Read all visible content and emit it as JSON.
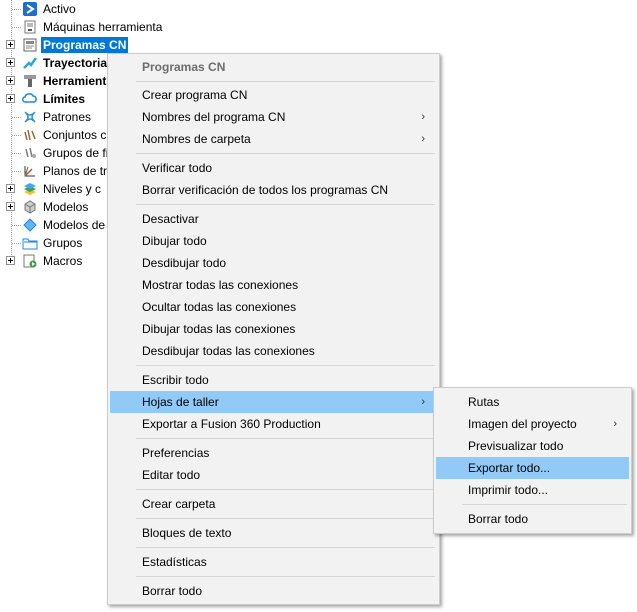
{
  "tree": {
    "items": [
      {
        "label": "Activo",
        "icon": "activo-icon",
        "bold": false,
        "selected": false,
        "expander": false
      },
      {
        "label": "Máquinas herramienta",
        "icon": "machine-tool-icon",
        "bold": false,
        "selected": false,
        "expander": false
      },
      {
        "label": "Programas CN",
        "icon": "nc-program-icon",
        "bold": true,
        "selected": true,
        "expander": true
      },
      {
        "label": "Trayectoria",
        "icon": "toolpath-icon",
        "bold": true,
        "selected": false,
        "expander": true
      },
      {
        "label": "Herramient",
        "icon": "tool-icon",
        "bold": true,
        "selected": false,
        "expander": true
      },
      {
        "label": "Límites",
        "icon": "boundary-icon",
        "bold": true,
        "selected": false,
        "expander": true
      },
      {
        "label": "Patrones",
        "icon": "pattern-icon",
        "bold": false,
        "selected": false,
        "expander": false
      },
      {
        "label": "Conjuntos c",
        "icon": "feature-set-icon",
        "bold": false,
        "selected": false,
        "expander": false
      },
      {
        "label": "Grupos de fi",
        "icon": "feature-group-icon",
        "bold": false,
        "selected": false,
        "expander": false
      },
      {
        "label": "Planos de tr",
        "icon": "workplane-icon",
        "bold": false,
        "selected": false,
        "expander": false
      },
      {
        "label": "Niveles y c",
        "icon": "levels-icon",
        "bold": false,
        "selected": false,
        "expander": true
      },
      {
        "label": "Modelos",
        "icon": "model-icon",
        "bold": false,
        "selected": false,
        "expander": true
      },
      {
        "label": "Modelos de",
        "icon": "stock-model-icon",
        "bold": false,
        "selected": false,
        "expander": false
      },
      {
        "label": "Grupos",
        "icon": "folder-icon",
        "bold": false,
        "selected": false,
        "expander": false
      },
      {
        "label": "Macros",
        "icon": "macro-icon",
        "bold": false,
        "selected": false,
        "expander": true
      }
    ]
  },
  "context_menu": {
    "header": "Programas CN",
    "items": [
      {
        "label": "Crear programa CN",
        "submenu": false
      },
      {
        "label": "Nombres del programa CN",
        "submenu": true
      },
      {
        "label": "Nombres de carpeta",
        "submenu": true
      },
      {
        "label": "Verificar todo",
        "submenu": false
      },
      {
        "label": "Borrar verificación de todos los programas CN",
        "submenu": false
      },
      {
        "label": "Desactivar",
        "submenu": false
      },
      {
        "label": "Dibujar todo",
        "submenu": false
      },
      {
        "label": "Desdibujar todo",
        "submenu": false
      },
      {
        "label": "Mostrar todas las conexiones",
        "submenu": false
      },
      {
        "label": "Ocultar todas las conexiones",
        "submenu": false
      },
      {
        "label": "Dibujar todas las conexiones",
        "submenu": false
      },
      {
        "label": "Desdibujar todas las conexiones",
        "submenu": false
      },
      {
        "label": "Escribir todo",
        "submenu": false
      },
      {
        "label": "Hojas de taller",
        "submenu": true,
        "highlighted": true
      },
      {
        "label": "Exportar a Fusion 360 Production",
        "submenu": false
      },
      {
        "label": "Preferencias",
        "submenu": false
      },
      {
        "label": "Editar todo",
        "submenu": false
      },
      {
        "label": "Crear carpeta",
        "submenu": false
      },
      {
        "label": "Bloques de texto",
        "submenu": false
      },
      {
        "label": "Estadísticas",
        "submenu": false
      },
      {
        "label": "Borrar todo",
        "submenu": false
      }
    ]
  },
  "submenu": {
    "items": [
      {
        "label": "Rutas",
        "submenu": false
      },
      {
        "label": "Imagen del proyecto",
        "submenu": true
      },
      {
        "label": "Previsualizar todo",
        "submenu": false
      },
      {
        "label": "Exportar todo...",
        "submenu": false,
        "highlighted": true
      },
      {
        "label": "Imprimir todo...",
        "submenu": false
      },
      {
        "label": "Borrar todo",
        "submenu": false
      }
    ]
  },
  "colors": {
    "selection": "#0078d7",
    "menu_background": "#f2f2f2",
    "menu_highlight": "#91c9f7"
  },
  "glyphs": {
    "submenu_arrow": "›"
  }
}
